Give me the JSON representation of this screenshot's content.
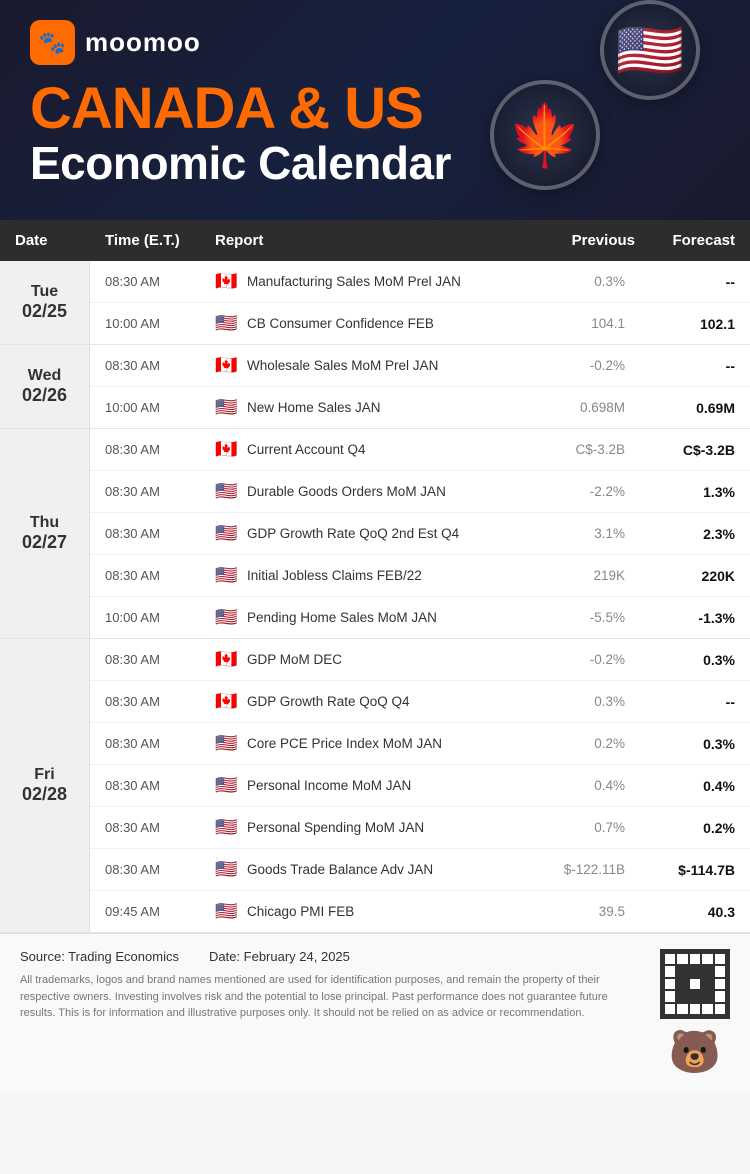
{
  "header": {
    "logo_text": "moomoo",
    "title_line1": "CANADA & US",
    "title_line2": "Economic Calendar",
    "flag_canada": "🍁",
    "flag_us": "🇺🇸"
  },
  "table": {
    "columns": [
      "Date",
      "Time (E.T.)",
      "Report",
      "Previous",
      "Forecast"
    ],
    "days": [
      {
        "day_name": "Tue",
        "day_date": "02/25",
        "rows": [
          {
            "time": "08:30 AM",
            "country": "CA",
            "flag": "🇨🇦",
            "report": "Manufacturing Sales MoM Prel JAN",
            "previous": "0.3%",
            "forecast": "--"
          },
          {
            "time": "10:00 AM",
            "country": "US",
            "flag": "🇺🇸",
            "report": "CB Consumer Confidence FEB",
            "previous": "104.1",
            "forecast": "102.1"
          }
        ]
      },
      {
        "day_name": "Wed",
        "day_date": "02/26",
        "rows": [
          {
            "time": "08:30 AM",
            "country": "CA",
            "flag": "🇨🇦",
            "report": "Wholesale Sales MoM Prel JAN",
            "previous": "-0.2%",
            "forecast": "--"
          },
          {
            "time": "10:00 AM",
            "country": "US",
            "flag": "🇺🇸",
            "report": "New Home Sales JAN",
            "previous": "0.698M",
            "forecast": "0.69M"
          }
        ]
      },
      {
        "day_name": "Thu",
        "day_date": "02/27",
        "rows": [
          {
            "time": "08:30 AM",
            "country": "CA",
            "flag": "🇨🇦",
            "report": "Current Account Q4",
            "previous": "C$-3.2B",
            "forecast": "C$-3.2B"
          },
          {
            "time": "08:30 AM",
            "country": "US",
            "flag": "🇺🇸",
            "report": "Durable Goods Orders MoM JAN",
            "previous": "-2.2%",
            "forecast": "1.3%"
          },
          {
            "time": "08:30 AM",
            "country": "US",
            "flag": "🇺🇸",
            "report": "GDP Growth Rate QoQ 2nd Est Q4",
            "previous": "3.1%",
            "forecast": "2.3%"
          },
          {
            "time": "08:30 AM",
            "country": "US",
            "flag": "🇺🇸",
            "report": "Initial Jobless Claims FEB/22",
            "previous": "219K",
            "forecast": "220K"
          },
          {
            "time": "10:00 AM",
            "country": "US",
            "flag": "🇺🇸",
            "report": "Pending Home Sales MoM JAN",
            "previous": "-5.5%",
            "forecast": "-1.3%"
          }
        ]
      },
      {
        "day_name": "Fri",
        "day_date": "02/28",
        "rows": [
          {
            "time": "08:30 AM",
            "country": "CA",
            "flag": "🇨🇦",
            "report": "GDP MoM DEC",
            "previous": "-0.2%",
            "forecast": "0.3%"
          },
          {
            "time": "08:30 AM",
            "country": "CA",
            "flag": "🇨🇦",
            "report": "GDP Growth Rate QoQ Q4",
            "previous": "0.3%",
            "forecast": "--"
          },
          {
            "time": "08:30 AM",
            "country": "US",
            "flag": "🇺🇸",
            "report": "Core PCE Price Index MoM JAN",
            "previous": "0.2%",
            "forecast": "0.3%"
          },
          {
            "time": "08:30 AM",
            "country": "US",
            "flag": "🇺🇸",
            "report": "Personal Income MoM JAN",
            "previous": "0.4%",
            "forecast": "0.4%"
          },
          {
            "time": "08:30 AM",
            "country": "US",
            "flag": "🇺🇸",
            "report": "Personal Spending MoM JAN",
            "previous": "0.7%",
            "forecast": "0.2%"
          },
          {
            "time": "08:30 AM",
            "country": "US",
            "flag": "🇺🇸",
            "report": "Goods Trade Balance Adv JAN",
            "previous": "$-122.11B",
            "forecast": "$-114.7B"
          },
          {
            "time": "09:45 AM",
            "country": "US",
            "flag": "🇺🇸",
            "report": "Chicago PMI FEB",
            "previous": "39.5",
            "forecast": "40.3"
          }
        ]
      }
    ]
  },
  "footer": {
    "source_label": "Source: Trading Economics",
    "date_label": "Date: February 24, 2025",
    "disclaimer": "All trademarks, logos and brand names mentioned are used for identification purposes, and remain the property of their respective owners. Investing involves risk and the potential to lose principal. Past performance does not guarantee future results. This is for information and illustrative purposes only. It should not be relied on as advice or recommendation."
  }
}
